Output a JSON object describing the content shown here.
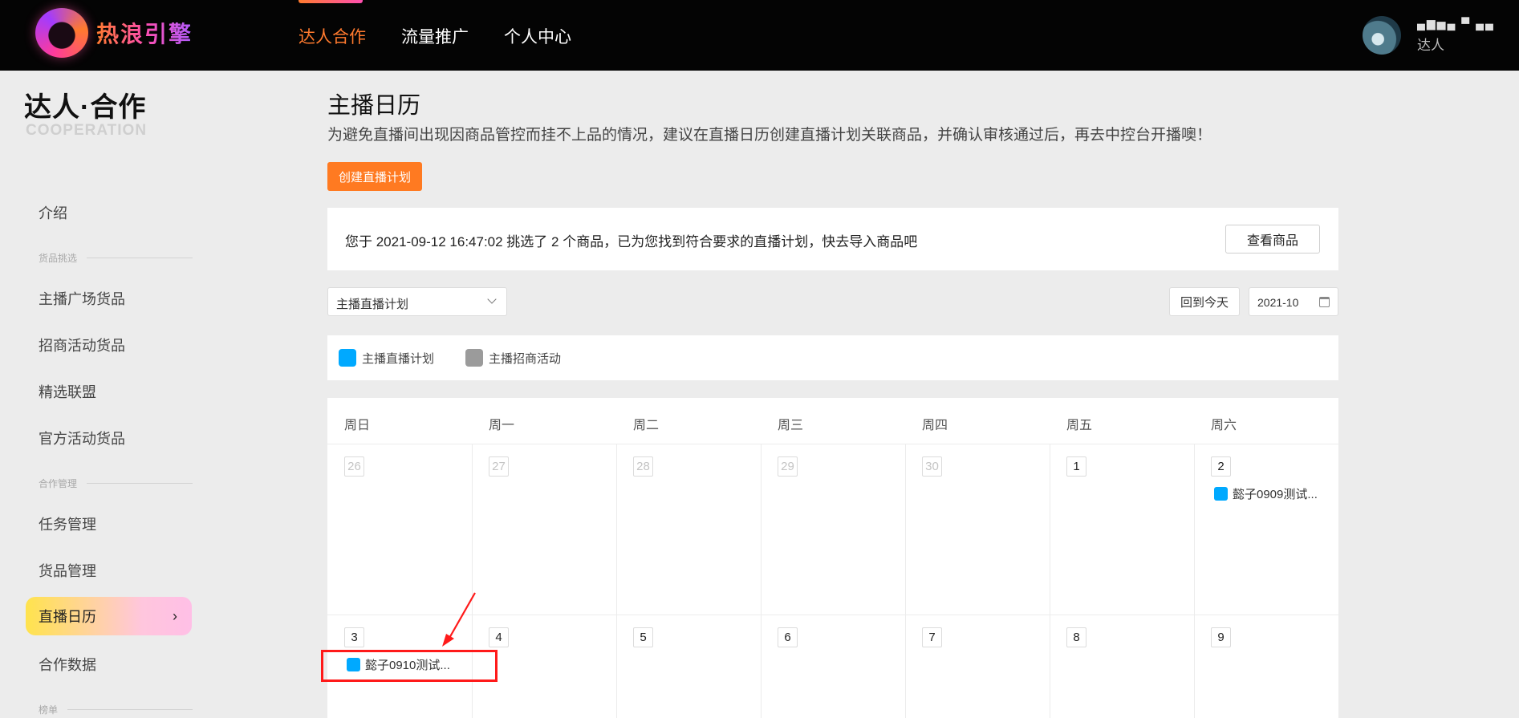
{
  "header": {
    "logo_text": "热浪引擎",
    "nav": [
      "达人合作",
      "流量推广",
      "个人中心"
    ],
    "user_name": "▄▆▅▄ ▀ ▄▄",
    "user_role": "达人"
  },
  "sidebar": {
    "brand_title": "达人·合作",
    "brand_sub": "COOPERATION",
    "intro": "介绍",
    "group_goods": "货品挑选",
    "goods_items": [
      "主播广场货品",
      "招商活动货品",
      "精选联盟",
      "官方活动货品"
    ],
    "group_coop": "合作管理",
    "coop_items": [
      "任务管理",
      "货品管理"
    ],
    "active_item": "直播日历",
    "after_active": "合作数据",
    "group_rank": "榜单"
  },
  "main": {
    "title": "主播日历",
    "description": "为避免直播间出现因商品管控而挂不上品的情况，建议在直播日历创建直播计划关联商品，并确认审核通过后，再去中控台开播噢！",
    "create_button": "创建直播计划",
    "notice_text": "您于 2021-09-12 16:47:02 挑选了 2 个商品，已为您找到符合要求的直播计划，快去导入商品吧",
    "view_button": "查看商品",
    "select_value": "主播直播计划",
    "today_button": "回到今天",
    "month_value": "2021-10"
  },
  "legend": [
    {
      "label": "主播直播计划",
      "color": "#00a9ff"
    },
    {
      "label": "主播招商活动",
      "color": "#9b9b9b"
    }
  ],
  "calendar": {
    "weekdays": [
      "周日",
      "周一",
      "周二",
      "周三",
      "周四",
      "周五",
      "周六"
    ],
    "week1": [
      "26",
      "27",
      "28",
      "29",
      "30",
      "1",
      "2"
    ],
    "week2": [
      "3",
      "4",
      "5",
      "6",
      "7",
      "8",
      "9"
    ],
    "event_sat": "懿子0909测试...",
    "event_sun": "懿子0910测试..."
  },
  "colors": {
    "accent": "#ff7a21",
    "plan_blue": "#00a9ff",
    "annotation_red": "#ff1a1a"
  }
}
